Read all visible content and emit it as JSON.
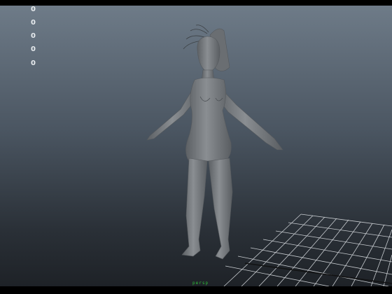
{
  "viewport": {
    "hud_values": [
      "0",
      "0",
      "0",
      "0",
      "0"
    ],
    "camera_label": "persp"
  },
  "colors": {
    "hud_text": "#e8ecef",
    "grid_line": "#d9dde1",
    "camera_label": "#2fbf3a",
    "model": "#7b7f83"
  }
}
